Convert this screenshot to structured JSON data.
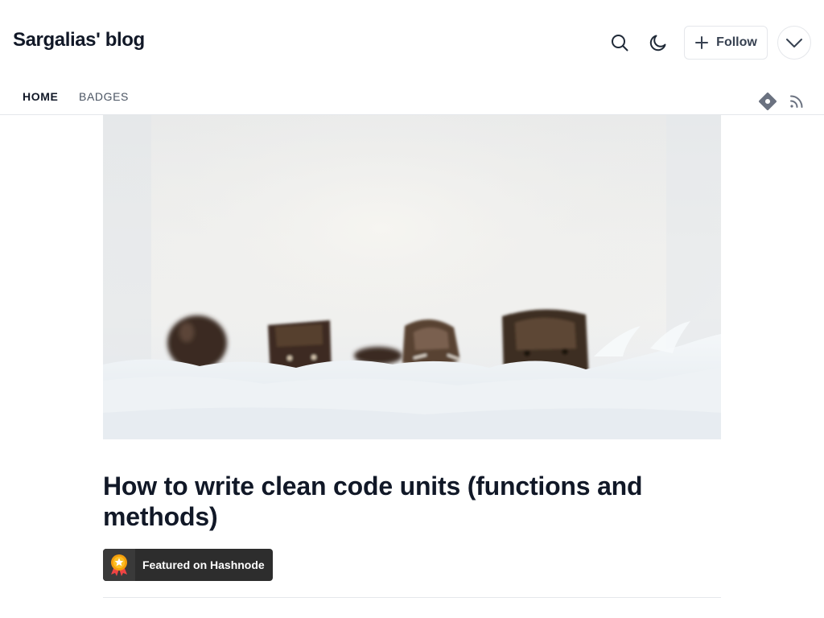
{
  "header": {
    "blog_title": "Sargalias' blog",
    "follow_label": "Follow",
    "icons": [
      "search-icon",
      "moon-icon",
      "plus-icon",
      "chevron-down-icon"
    ]
  },
  "nav": {
    "items": [
      {
        "label": "HOME",
        "active": true
      },
      {
        "label": "BADGES",
        "active": false
      }
    ],
    "icons": [
      "hashnode-icon",
      "rss-icon"
    ]
  },
  "article": {
    "title": "How to write clean code units (functions and methods)",
    "featured_badge": "Featured on Hashnode"
  },
  "colors": {
    "text": "#111827",
    "muted": "#4b5563",
    "border": "#e5e7eb",
    "badge_bg": "#2d2d2d",
    "badge_accent": "#f59e0b"
  }
}
